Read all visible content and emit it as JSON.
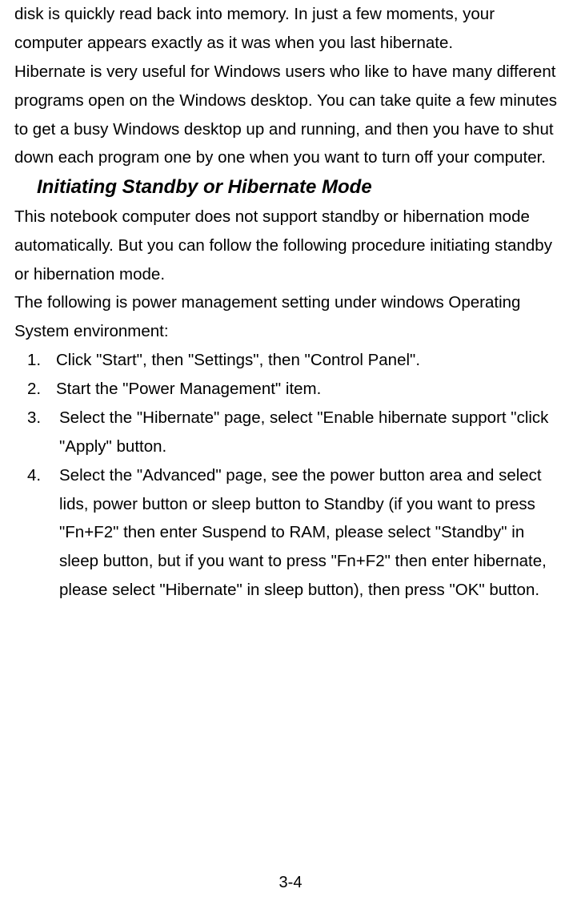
{
  "paragraph1": "disk is quickly read back into memory. In just a few moments, your computer appears exactly as it was when you last hibernate.",
  "paragraph2": "Hibernate is very useful for Windows users who like to have many different programs open on the Windows desktop. You can take quite a few minutes to get a busy Windows desktop up and running, and then you have to shut down each program one by one when you want to turn off your computer.",
  "heading": "Initiating Standby or Hibernate Mode",
  "paragraph3": "This notebook computer does not support standby or hibernation mode automatically. But you can follow the following procedure initiating standby or hibernation mode.",
  "paragraph4": "The following is power management setting under windows Operating System environment:",
  "list": {
    "item1": {
      "num": "1.",
      "text": "Click \"Start\", then \"Settings\", then \"Control Panel\"."
    },
    "item2": {
      "num": "2.",
      "text": "Start the \"Power Management\" item."
    },
    "item3": {
      "num": "3.",
      "text": "Select the \"Hibernate\" page, select \"Enable hibernate support \"click \"Apply\" button."
    },
    "item4": {
      "num": "4.",
      "text": "Select the \"Advanced\" page, see the power button area and select lids, power button or sleep button to Standby (if you want to press \"Fn+F2\" then enter Suspend to RAM, please select \"Standby\" in sleep button, but if you want to press \"Fn+F2\" then enter hibernate, please select \"Hibernate\" in sleep button), then press \"OK\" button."
    }
  },
  "pageNumber": "3-4"
}
